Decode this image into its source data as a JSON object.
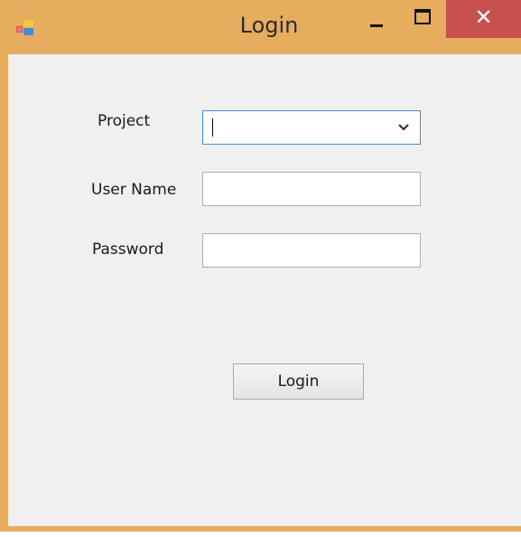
{
  "window": {
    "title": "Login",
    "close_glyph": "✕",
    "frame_color": "#e7ad5f",
    "close_color": "#c7504c",
    "client_color": "#f0f0f0"
  },
  "form": {
    "project_label": "Project",
    "project_value": "",
    "username_label": "User Name",
    "username_value": "",
    "password_label": "Password",
    "password_value": "",
    "login_button": "Login"
  },
  "icons": {
    "app": "app-icon",
    "minimize": "minimize-icon",
    "maximize": "maximize-icon",
    "close": "close-icon",
    "dropdown": "chevron-down-icon"
  }
}
